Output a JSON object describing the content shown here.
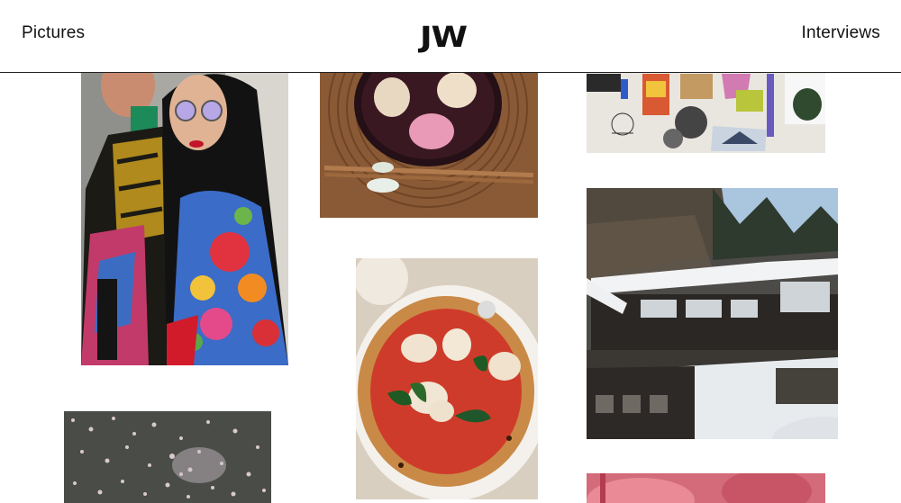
{
  "header": {
    "left_link": "Pictures",
    "logo": "JW",
    "right_link": "Interviews"
  },
  "gallery": {
    "items": [
      {
        "name": "photo-two-women-floral"
      },
      {
        "name": "photo-soup-bowl"
      },
      {
        "name": "photo-collage-board"
      },
      {
        "name": "photo-pizza"
      },
      {
        "name": "photo-snowy-building"
      },
      {
        "name": "photo-petals-on-water"
      },
      {
        "name": "photo-pink-abstract"
      }
    ]
  },
  "colors": {
    "text": "#111111",
    "background": "#ffffff",
    "divider": "#222222"
  }
}
